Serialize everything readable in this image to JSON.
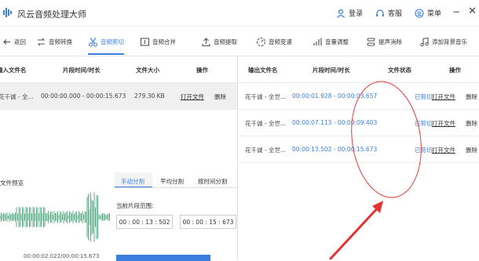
{
  "app": {
    "title": "风云音频处理大师"
  },
  "titlebar": {
    "login": "登录",
    "service": "客服",
    "menu": "菜单"
  },
  "toolbar": {
    "back": "返回",
    "items": [
      "音频转换",
      "音频剪切",
      "音频合并",
      "音频提取",
      "音频变速",
      "音量调整",
      "提声消除",
      "添加背景音乐"
    ]
  },
  "input_table": {
    "headers": [
      "输入文件名",
      "片段时间/时长",
      "文件大小",
      "操作"
    ],
    "rows": [
      {
        "name": "花千诚 - 全...",
        "time": "00:00:00.000 - 00:00:15.673",
        "size": "279.30 KB",
        "open": "打开文件",
        "delete": "删除"
      }
    ]
  },
  "output_table": {
    "headers": [
      "输出文件名",
      "片段时间/时长",
      "文件状态",
      "操作"
    ],
    "rows": [
      {
        "name": "花千诚 - 全世...",
        "time": "00:00:01.928 - 00:00:03.657",
        "status": "已剪切",
        "open": "打开文件",
        "delete": "删除"
      },
      {
        "name": "花千诚 - 全世...",
        "time": "00:00:07.113 - 00:00:09.403",
        "status": "已剪切",
        "open": "打开文件",
        "delete": "删除"
      },
      {
        "name": "花千诚 - 全世...",
        "time": "00:00:13.502 - 00:00:15.673",
        "status": "已剪切",
        "open": "打开文件",
        "delete": "删除"
      }
    ]
  },
  "preview": {
    "title": "文件预览",
    "tabs": [
      "手动分割",
      "平均分割",
      "按时间分割"
    ],
    "range_label": "当前片段范围:",
    "start": "00 : 00 : 13 : 502",
    "end": "00 : 00 : 15 : 673",
    "position": "00:00:02.022/00:00:15.673"
  },
  "colors": {
    "accent": "#3a7fe0",
    "highlight": "#e33333",
    "wave": "#5cae8a"
  }
}
